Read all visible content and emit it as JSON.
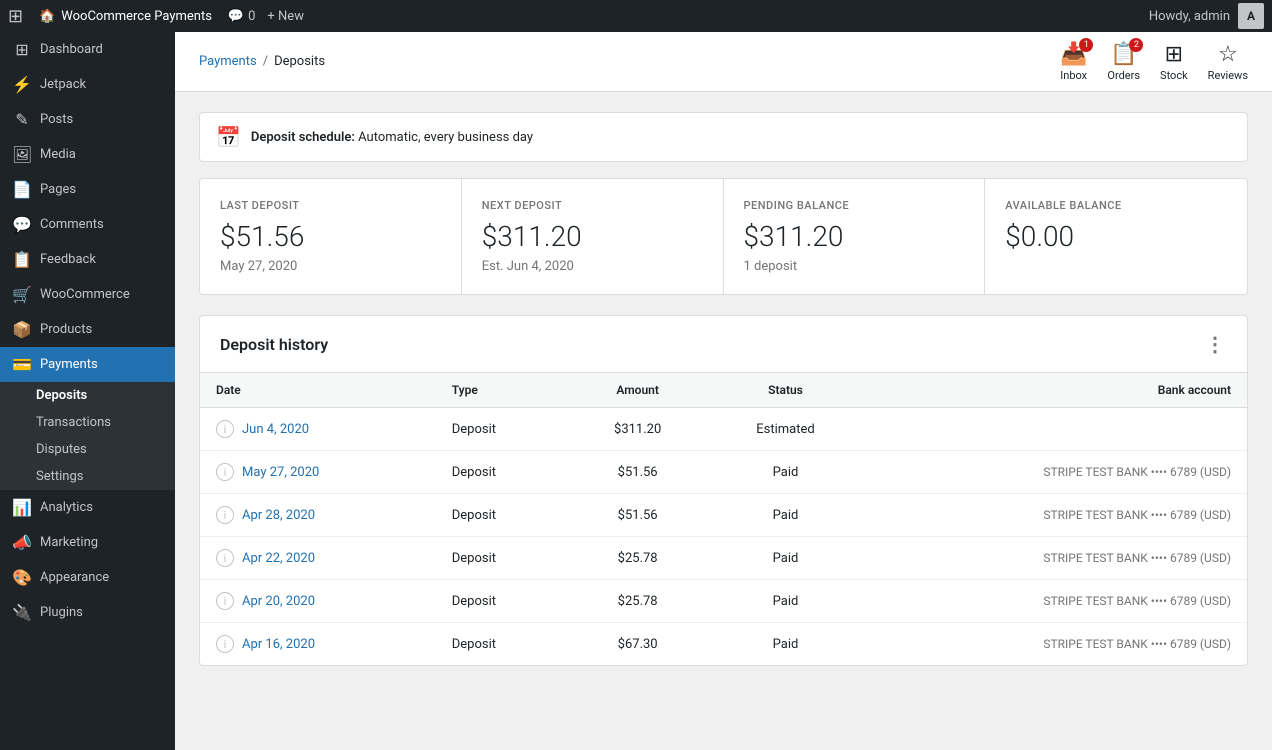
{
  "adminBar": {
    "wpLogo": "⊞",
    "siteName": "WooCommerce Payments",
    "commentsIcon": "💬",
    "commentsCount": "0",
    "newLabel": "+ New",
    "howdy": "Howdy, admin",
    "avatarInitial": "A"
  },
  "sidebar": {
    "items": [
      {
        "id": "dashboard",
        "label": "Dashboard",
        "icon": "⊞"
      },
      {
        "id": "jetpack",
        "label": "Jetpack",
        "icon": "⚡"
      },
      {
        "id": "posts",
        "label": "Posts",
        "icon": "✎"
      },
      {
        "id": "media",
        "label": "Media",
        "icon": "🖼"
      },
      {
        "id": "pages",
        "label": "Pages",
        "icon": "📄"
      },
      {
        "id": "comments",
        "label": "Comments",
        "icon": "💬"
      },
      {
        "id": "feedback",
        "label": "Feedback",
        "icon": "📋"
      },
      {
        "id": "woocommerce",
        "label": "WooCommerce",
        "icon": "🛒"
      },
      {
        "id": "products",
        "label": "Products",
        "icon": "📦"
      },
      {
        "id": "payments",
        "label": "Payments",
        "icon": "💳",
        "active": true
      }
    ],
    "paymentsSubItems": [
      {
        "id": "deposits",
        "label": "Deposits",
        "active": true
      },
      {
        "id": "transactions",
        "label": "Transactions"
      },
      {
        "id": "disputes",
        "label": "Disputes"
      },
      {
        "id": "settings",
        "label": "Settings"
      }
    ],
    "bottomItems": [
      {
        "id": "analytics",
        "label": "Analytics",
        "icon": "📊"
      },
      {
        "id": "marketing",
        "label": "Marketing",
        "icon": "📣"
      },
      {
        "id": "appearance",
        "label": "Appearance",
        "icon": "🎨"
      },
      {
        "id": "plugins",
        "label": "Plugins",
        "icon": "🔌"
      }
    ]
  },
  "toolbar": {
    "breadcrumb": {
      "parent": "Payments",
      "separator": "/",
      "current": "Deposits"
    },
    "icons": [
      {
        "id": "inbox",
        "label": "Inbox",
        "icon": "📥",
        "badge": "1"
      },
      {
        "id": "orders",
        "label": "Orders",
        "icon": "📋",
        "badge": "2"
      },
      {
        "id": "stock",
        "label": "Stock",
        "icon": "⊞",
        "badge": null
      },
      {
        "id": "reviews",
        "label": "Reviews",
        "icon": "☆",
        "badge": null
      }
    ]
  },
  "depositSchedule": {
    "icon": "📅",
    "labelBold": "Deposit schedule:",
    "labelText": "Automatic, every business day"
  },
  "stats": [
    {
      "id": "last-deposit",
      "label": "LAST DEPOSIT",
      "value": "$51.56",
      "sub": "May 27, 2020"
    },
    {
      "id": "next-deposit",
      "label": "NEXT DEPOSIT",
      "value": "$311.20",
      "sub": "Est. Jun 4, 2020"
    },
    {
      "id": "pending-balance",
      "label": "PENDING BALANCE",
      "value": "$311.20",
      "sub": "1 deposit"
    },
    {
      "id": "available-balance",
      "label": "AVAILABLE BALANCE",
      "value": "$0.00",
      "sub": ""
    }
  ],
  "depositHistory": {
    "title": "Deposit history",
    "columns": [
      "Date",
      "Type",
      "Amount",
      "Status",
      "Bank account"
    ],
    "rows": [
      {
        "date": "Jun 4, 2020",
        "type": "Deposit",
        "amount": "$311.20",
        "status": "Estimated",
        "bank": ""
      },
      {
        "date": "May 27, 2020",
        "type": "Deposit",
        "amount": "$51.56",
        "status": "Paid",
        "bank": "STRIPE TEST BANK •••• 6789 (USD)"
      },
      {
        "date": "Apr 28, 2020",
        "type": "Deposit",
        "amount": "$51.56",
        "status": "Paid",
        "bank": "STRIPE TEST BANK •••• 6789 (USD)"
      },
      {
        "date": "Apr 22, 2020",
        "type": "Deposit",
        "amount": "$25.78",
        "status": "Paid",
        "bank": "STRIPE TEST BANK •••• 6789 (USD)"
      },
      {
        "date": "Apr 20, 2020",
        "type": "Deposit",
        "amount": "$25.78",
        "status": "Paid",
        "bank": "STRIPE TEST BANK •••• 6789 (USD)"
      },
      {
        "date": "Apr 16, 2020",
        "type": "Deposit",
        "amount": "$67.30",
        "status": "Paid",
        "bank": "STRIPE TEST BANK •••• 6789 (USD)"
      }
    ]
  }
}
